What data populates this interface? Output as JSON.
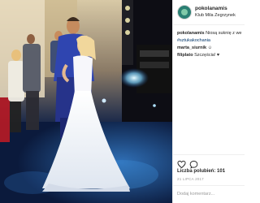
{
  "post": {
    "username": "pokolanamis",
    "location": "Klub Mila Zegrzynek",
    "comments": [
      {
        "user": "pokolanamis",
        "text": "Niosą suknię z we",
        "hashtag": "#sztukakochania"
      },
      {
        "user": "marta_siurnik",
        "text": "☺"
      },
      {
        "user": "filiplato",
        "text": "Szczęścia! ♥"
      }
    ],
    "likes_label": "Liczba polubień:",
    "likes_count": "101",
    "date": "21 LIPCA 2017",
    "add_comment_placeholder": "Dodaj komentarz..."
  },
  "icons": {
    "like": "heart-outline-icon",
    "comment": "comment-bubble-icon"
  },
  "colors": {
    "hashtag": "#003569",
    "text": "#262626",
    "muted": "#999999",
    "divider": "#efefef"
  }
}
